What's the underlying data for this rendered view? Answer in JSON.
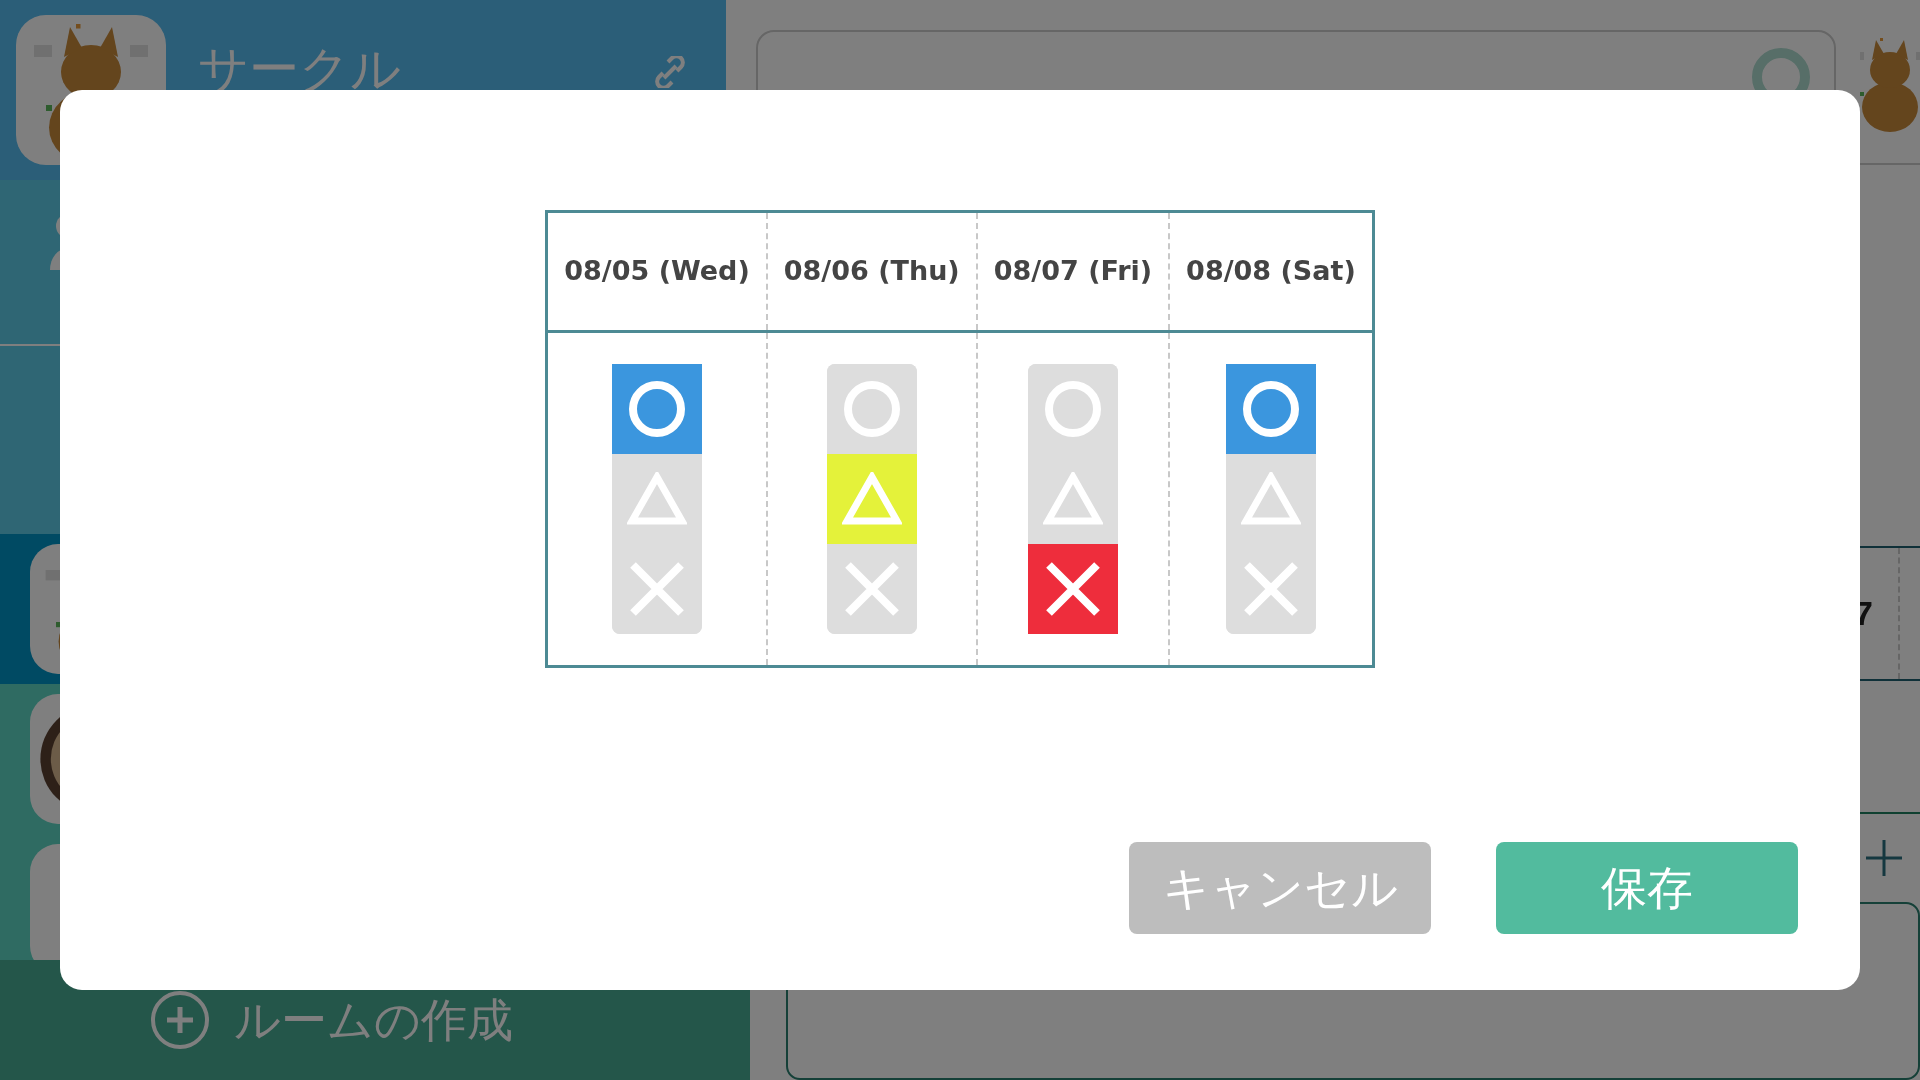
{
  "sidebar": {
    "circle_title": "サークル",
    "rooms": [
      {
        "selected": true
      },
      {
        "selected": false
      },
      {
        "selected": false
      }
    ],
    "create_room": "ルームの作成"
  },
  "main": {
    "table_cell": "7"
  },
  "modal": {
    "columns": [
      {
        "date": "08/05 (Wed)",
        "options": [
          {
            "kind": "circle",
            "selected": true
          },
          {
            "kind": "triangle",
            "selected": false
          },
          {
            "kind": "cross",
            "selected": false
          }
        ]
      },
      {
        "date": "08/06 (Thu)",
        "options": [
          {
            "kind": "circle",
            "selected": false
          },
          {
            "kind": "triangle",
            "selected": true
          },
          {
            "kind": "cross",
            "selected": false
          }
        ]
      },
      {
        "date": "08/07 (Fri)",
        "options": [
          {
            "kind": "circle",
            "selected": false
          },
          {
            "kind": "triangle",
            "selected": false
          },
          {
            "kind": "cross",
            "selected": true
          }
        ]
      },
      {
        "date": "08/08 (Sat)",
        "options": [
          {
            "kind": "circle",
            "selected": true
          },
          {
            "kind": "triangle",
            "selected": false
          },
          {
            "kind": "cross",
            "selected": false
          }
        ]
      }
    ],
    "buttons": [
      {
        "kind": "cancel",
        "label": "キャンセル"
      },
      {
        "kind": "save",
        "label": "保存"
      }
    ]
  }
}
